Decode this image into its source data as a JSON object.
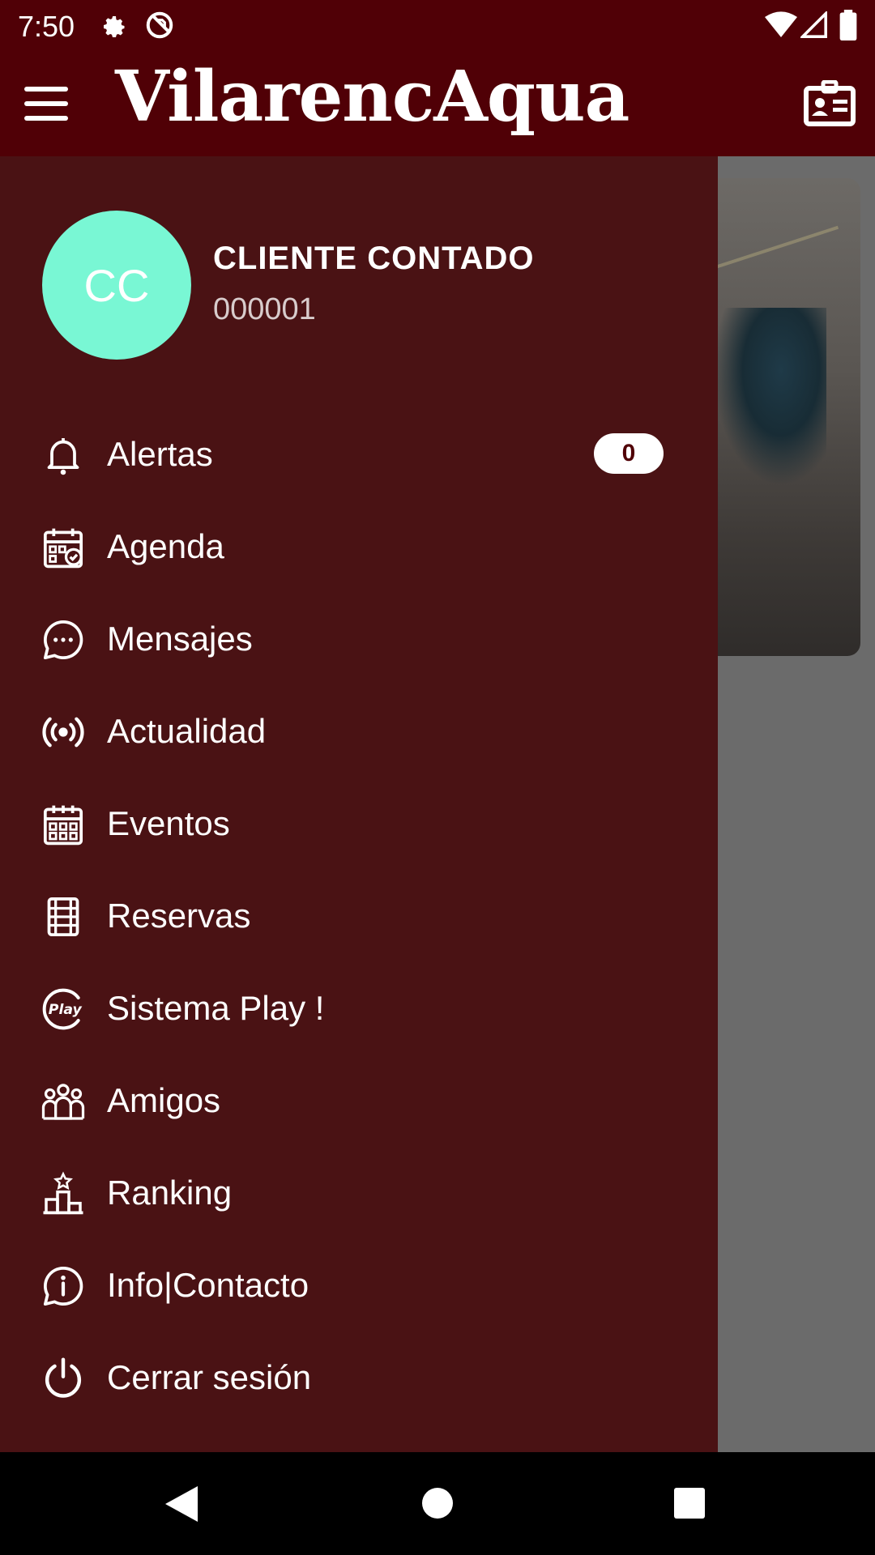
{
  "status_bar": {
    "time": "7:50",
    "icons": [
      "gear-icon",
      "no-sim-icon",
      "wifi-icon",
      "cell-signal-icon",
      "battery-icon"
    ]
  },
  "app_bar": {
    "brand": "VilarencAqua",
    "left_icon": "menu-icon",
    "right_icon": "id-card-icon"
  },
  "colors": {
    "primary": "#500006",
    "drawer": "#4a1214",
    "avatar": "#79f7d4",
    "text": "#ffffff"
  },
  "profile": {
    "initials": "CC",
    "name": "CLIENTE CONTADO",
    "code": "000001"
  },
  "menu": [
    {
      "label": "Alertas",
      "icon": "bell-icon",
      "badge": "0"
    },
    {
      "label": "Agenda",
      "icon": "calendar-check-icon"
    },
    {
      "label": "Mensajes",
      "icon": "chat-bubble-icon"
    },
    {
      "label": "Actualidad",
      "icon": "broadcast-icon"
    },
    {
      "label": "Eventos",
      "icon": "calendar-grid-icon"
    },
    {
      "label": "Reservas",
      "icon": "court-icon"
    },
    {
      "label": "Sistema Play !",
      "icon": "play-logo-icon"
    },
    {
      "label": "Amigos",
      "icon": "group-icon"
    },
    {
      "label": "Ranking",
      "icon": "podium-icon"
    },
    {
      "label": "Info|Contacto",
      "icon": "info-bubble-icon"
    },
    {
      "label": "Cerrar sesión",
      "icon": "power-icon"
    }
  ],
  "nav_bar": {
    "buttons": [
      "back-icon",
      "home-icon",
      "recents-icon"
    ]
  }
}
